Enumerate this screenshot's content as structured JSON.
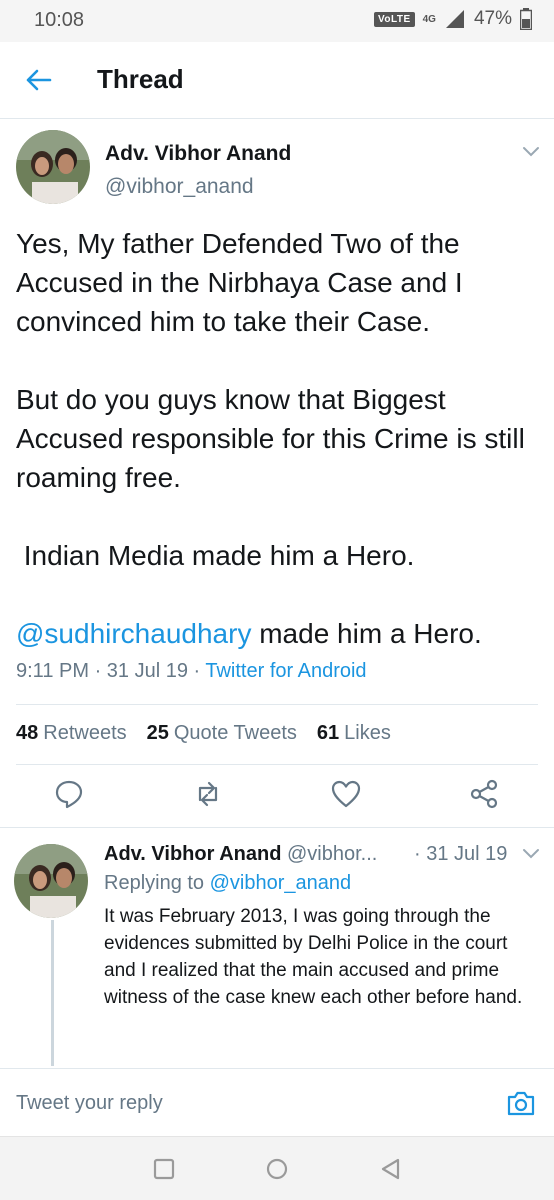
{
  "status_bar": {
    "time": "10:08",
    "volte": "VoLTE",
    "network": "4G",
    "battery": "47%"
  },
  "header": {
    "title": "Thread"
  },
  "main_tweet": {
    "author_name": "Adv. Vibhor Anand",
    "author_handle": "@vibhor_anand",
    "paragraph1": "Yes, My father Defended Two of the Accused in the Nirbhaya Case and I convinced him to take their Case.",
    "paragraph2": "But do you guys know that Biggest Accused responsible for this Crime is still roaming free.",
    "paragraph3": " Indian Media made him a Hero.",
    "paragraph4_mention": "@sudhirchaudhary",
    "paragraph4_rest": " made him a Hero.",
    "time": "9:11 PM",
    "date": "31 Jul 19",
    "source": "Twitter for Android",
    "stats": {
      "retweets_count": "48",
      "retweets_label": "Retweets",
      "quotes_count": "25",
      "quotes_label": "Quote Tweets",
      "likes_count": "61",
      "likes_label": "Likes"
    }
  },
  "reply_tweet": {
    "author_name": "Adv. Vibhor Anand",
    "author_handle": "@vibhor...",
    "date": "· 31 Jul 19",
    "replying_label": "Replying to",
    "replying_to": "@vibhor_anand",
    "text": "It was February 2013, I was going through the evidences submitted by Delhi Police in the court and I realized that the main accused and prime witness of the case knew each other before hand."
  },
  "compose": {
    "placeholder": "Tweet your reply"
  },
  "colors": {
    "accent": "#1b95e0",
    "secondary_text": "#657786",
    "divider": "#e1e8ed"
  }
}
